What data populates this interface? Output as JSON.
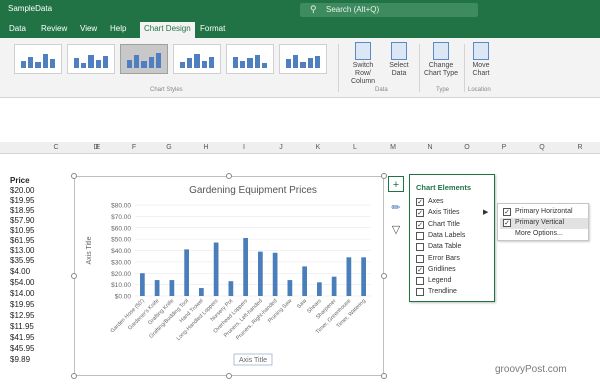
{
  "window": {
    "title": "SampleData",
    "search_placeholder": "Search (Alt+Q)"
  },
  "tabs": [
    "Data",
    "Review",
    "View",
    "Help",
    "Chart Design",
    "Format"
  ],
  "active_tab": "Chart Design",
  "ribbon": {
    "chart_styles_label": "Chart Styles",
    "data_group_label": "Data",
    "type_group_label": "Type",
    "location_group_label": "Location",
    "switch_label": [
      "Switch Row/",
      "Column"
    ],
    "select_label": [
      "Select",
      "Data"
    ],
    "change_label": [
      "Change",
      "Chart Type"
    ],
    "move_label": [
      "Move",
      "Chart"
    ]
  },
  "columns": [
    "C",
    "D",
    "E",
    "F",
    "G",
    "H",
    "I",
    "J",
    "K",
    "L",
    "M",
    "N",
    "O",
    "P",
    "Q",
    "R"
  ],
  "price_header": "Price",
  "prices": [
    "$20.00",
    "$19.95",
    "$18.95",
    "$57.90",
    "$10.95",
    "$61.95",
    "$13.00",
    "$35.95",
    "$4.00",
    "$54.00",
    "$14.00",
    "$19.95",
    "$12.95",
    "$11.95",
    "$41.95",
    "$45.95",
    "$9.89"
  ],
  "chart_data": {
    "type": "bar",
    "title": "Gardening Equipment Prices",
    "xlabel": "Axis Title",
    "ylabel": "Axis Title",
    "ylim": [
      0,
      80
    ],
    "yticks": [
      "$0.00",
      "$10.00",
      "$20.00",
      "$30.00",
      "$40.00",
      "$50.00",
      "$60.00",
      "$70.00",
      "$80.00"
    ],
    "categories": [
      "Garden Hose (50')",
      "Gardener's Knife",
      "Grafting Knife",
      "Grafting/Budding Tool",
      "Hand Trowel",
      "Long-Handled Loppers",
      "Nursery Pot",
      "Overhead Loppers",
      "Pruners, Left-handed",
      "Pruners, Right-handed",
      "Pruning Saw",
      "Saw",
      "Shears",
      "Sharpener",
      "Timer, Greenhouse",
      "Timer, Watering"
    ],
    "values": [
      20,
      14,
      14,
      41,
      7,
      47,
      13,
      51,
      39,
      38,
      14,
      26,
      12,
      17,
      34,
      34
    ],
    "color": "#4a7ebb"
  },
  "chart_elements": {
    "title": "Chart Elements",
    "items": [
      {
        "label": "Axes",
        "checked": true
      },
      {
        "label": "Axis Titles",
        "checked": true
      },
      {
        "label": "Chart Title",
        "checked": true
      },
      {
        "label": "Data Labels",
        "checked": false
      },
      {
        "label": "Data Table",
        "checked": false
      },
      {
        "label": "Error Bars",
        "checked": false
      },
      {
        "label": "Gridlines",
        "checked": true
      },
      {
        "label": "Legend",
        "checked": false
      },
      {
        "label": "Trendline",
        "checked": false
      }
    ]
  },
  "axis_titles_submenu": [
    {
      "label": "Primary Horizontal",
      "checked": true
    },
    {
      "label": "Primary Vertical",
      "checked": true
    },
    {
      "label": "More Options...",
      "checked": false
    }
  ],
  "watermark": "groovyPost.com",
  "colors": {
    "brand": "#217346",
    "bar": "#4a7ebb"
  }
}
